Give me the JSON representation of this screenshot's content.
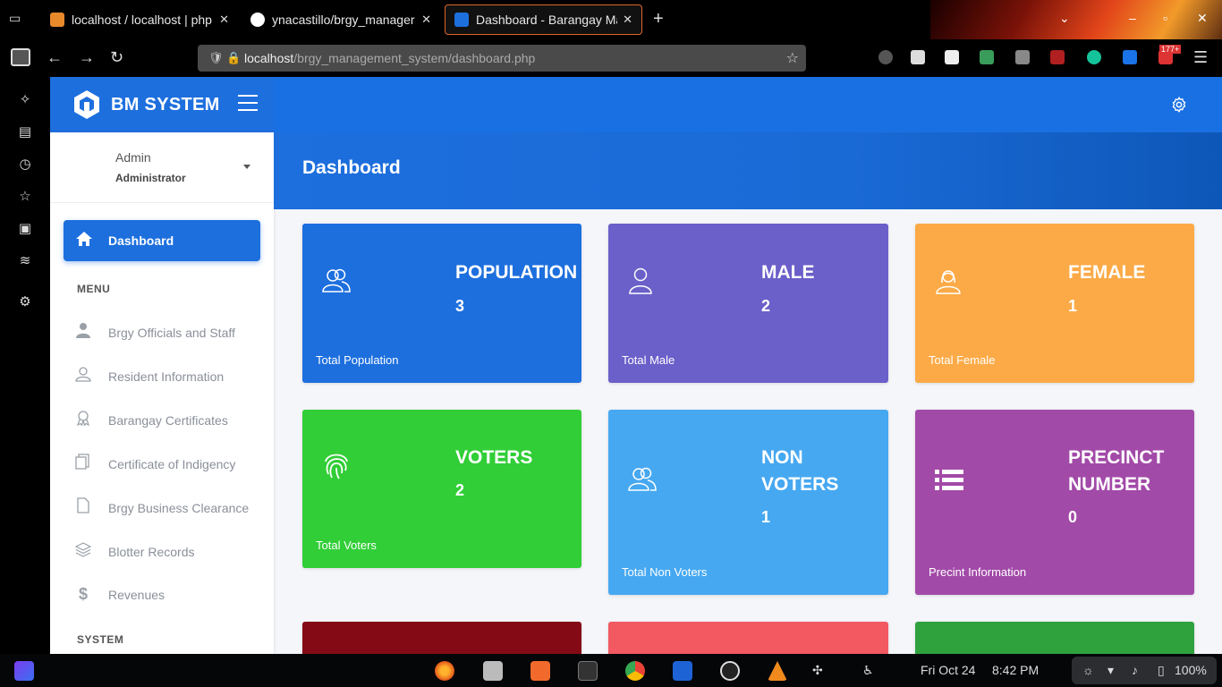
{
  "browser": {
    "tabs": [
      {
        "title": "localhost / localhost | php",
        "active": false
      },
      {
        "title": "ynacastillo/brgy_manager",
        "active": false
      },
      {
        "title": "Dashboard - Barangay Ma",
        "active": true
      }
    ],
    "url_host": "localhost",
    "url_path": "/brgy_management_system/dashboard.php",
    "badge_count": "177+"
  },
  "app": {
    "brand": "BM SYSTEM",
    "user": {
      "name": "Admin",
      "role": "Administrator"
    },
    "nav_active": "Dashboard",
    "section_menu": "MENU",
    "section_system": "SYSTEM",
    "menu": [
      {
        "label": "Brgy Officials and Staff",
        "icon": "user-tie-icon"
      },
      {
        "label": "Resident Information",
        "icon": "user-icon"
      },
      {
        "label": "Barangay Certificates",
        "icon": "award-icon"
      },
      {
        "label": "Certificate of Indigency",
        "icon": "files-icon"
      },
      {
        "label": "Brgy Business Clearance",
        "icon": "file-icon"
      },
      {
        "label": "Blotter Records",
        "icon": "layers-icon"
      },
      {
        "label": "Revenues",
        "icon": "dollar-icon"
      }
    ],
    "page_title": "Dashboard"
  },
  "cards": [
    {
      "title": "POPULATION",
      "value": "3",
      "footer": "Total Population",
      "color": "#1d6fde",
      "icon": "users-icon"
    },
    {
      "title": "MALE",
      "value": "2",
      "footer": "Total Male",
      "color": "#6b5fc9",
      "icon": "male-icon"
    },
    {
      "title": "FEMALE",
      "value": "1",
      "footer": "Total Female",
      "color": "#fcaa47",
      "icon": "female-icon"
    },
    {
      "title": "VOTERS",
      "value": "2",
      "footer": "Total Voters",
      "color": "#31ce37",
      "icon": "fingerprint-icon"
    },
    {
      "title": "NON VOTERS",
      "value": "1",
      "footer": "Total Non Voters",
      "color": "#46a8f1",
      "icon": "users-icon"
    },
    {
      "title": "PRECINCT NUMBER",
      "value": "0",
      "footer": "Precint Information",
      "color": "#a24aa8",
      "icon": "list-icon"
    }
  ],
  "bottom_cards_colors": [
    "#840a15",
    "#f25961",
    "#2fa23e"
  ],
  "taskbar": {
    "date": "Fri Oct 24",
    "time": "8:42 PM",
    "battery": "100%"
  }
}
